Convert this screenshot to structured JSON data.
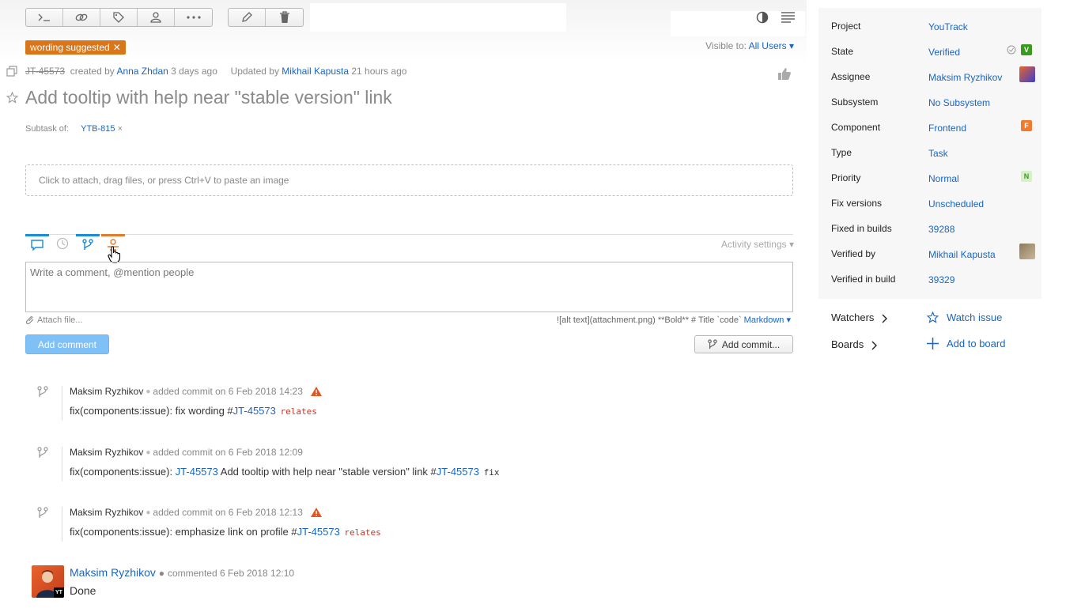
{
  "toolbar": {
    "groups": [
      [
        "command-icon",
        "link-icon",
        "tag-icon",
        "user-icon",
        "more-icon"
      ],
      [
        "edit-icon",
        "delete-icon"
      ]
    ]
  },
  "tag": {
    "label": "wording suggested",
    "remove": "✕"
  },
  "visibility": {
    "label": "Visible to:",
    "value": "All Users ▾"
  },
  "issue": {
    "id": "JT-45573",
    "created_by_label": "created by",
    "creator": "Anna Zhdan",
    "created_ago": "3 days ago",
    "updated_by_label": "Updated by",
    "updater": "Mikhail Kapusta",
    "updated_ago": "21 hours ago",
    "title": "Add tooltip with help near \"stable version\" link",
    "subtask_label": "Subtask of:",
    "subtask_value": "YTB-815",
    "subtask_remove": "×"
  },
  "attach_drop": "Click to attach, drag files, or press Ctrl+V to paste an image",
  "activity": {
    "settings": "Activity settings ▾",
    "comment_placeholder": "Write a comment, @mention people",
    "attach_file": "Attach file...",
    "markdown_hint": "![alt text](attachment.png) **Bold** # Title `code`",
    "markdown_label": "Markdown ▾",
    "add_comment": "Add comment",
    "add_commit": "Add commit..."
  },
  "commits": [
    {
      "author": "Maksim Ryzhikov",
      "action": "added commit on 6 Feb 2018 14:23",
      "warn": true,
      "prefix": "fix(components:issue): fix wording #",
      "ref1": "",
      "mid": "",
      "ref": "JT-45573",
      "code": "relates",
      "code_red": true
    },
    {
      "author": "Maksim Ryzhikov",
      "action": "added commit on 6 Feb 2018 12:09",
      "warn": false,
      "prefix": "fix(components:issue): ",
      "ref1": "JT-45573",
      "mid": " Add tooltip with help near \"stable version\" link #",
      "ref": "JT-45573",
      "code": "fix",
      "code_red": false
    },
    {
      "author": "Maksim Ryzhikov",
      "action": "added commit on 6 Feb 2018 12:13",
      "warn": true,
      "prefix": "fix(components:issue): emphasize link on profile #",
      "ref1": "",
      "mid": "",
      "ref": "JT-45573",
      "code": "relates",
      "code_red": true
    }
  ],
  "comment": {
    "author": "Maksim Ryzhikov",
    "meta": "commented 6 Feb 2018 12:10",
    "text": "Done",
    "badge": "YT"
  },
  "sidebar": {
    "fields": [
      {
        "label": "Project",
        "value": "YouTrack"
      },
      {
        "label": "State",
        "value": "Verified",
        "badge": "V",
        "badge_color": "#3a9a1f"
      },
      {
        "label": "Assignee",
        "value": "Maksim Ryzhikov",
        "avatar": true
      },
      {
        "label": "Subsystem",
        "value": "No Subsystem"
      },
      {
        "label": "Component",
        "value": "Frontend",
        "badge": "F",
        "badge_color": "#f07a2e"
      },
      {
        "label": "Type",
        "value": "Task"
      },
      {
        "label": "Priority",
        "value": "Normal",
        "badge": "N",
        "badge_color": "#d6f0c8"
      },
      {
        "label": "Fix versions",
        "value": "Unscheduled"
      },
      {
        "label": "Fixed in builds",
        "value": "39288"
      },
      {
        "label": "Verified by",
        "value": "Mikhail Kapusta",
        "avatar": true
      },
      {
        "label": "Verified in build",
        "value": "39329"
      }
    ],
    "watchers": "Watchers",
    "watch_issue": "Watch issue",
    "boards": "Boards",
    "add_to_board": "Add to board"
  }
}
